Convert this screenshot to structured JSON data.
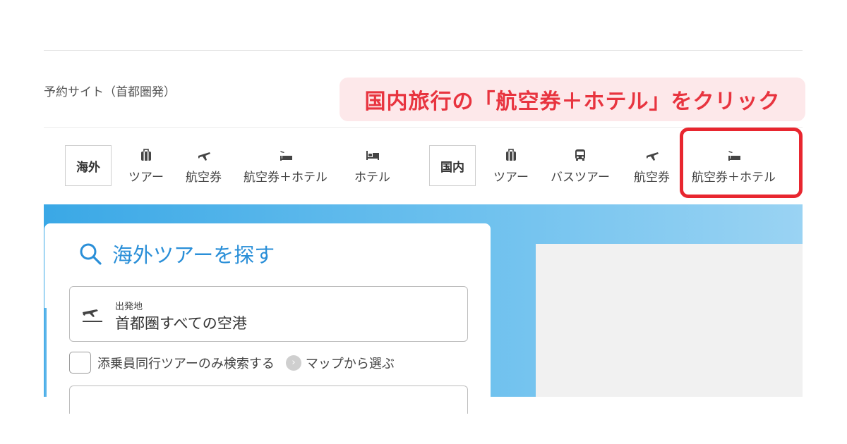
{
  "header": {
    "subtitle": "予約サイト（首都圏発）"
  },
  "callout": {
    "text": "国内旅行の「航空券＋ホテル」をクリック",
    "color": "#e8343f",
    "background": "#fde8ea"
  },
  "nav": {
    "overseas": {
      "badge": "海外",
      "items": [
        {
          "label": "ツアー",
          "icon": "suitcase-icon"
        },
        {
          "label": "航空券",
          "icon": "airplane-icon"
        },
        {
          "label": "航空券＋ホテル",
          "icon": "flight-hotel-icon"
        },
        {
          "label": "ホテル",
          "icon": "bed-icon"
        }
      ]
    },
    "domestic": {
      "badge": "国内",
      "items": [
        {
          "label": "ツアー",
          "icon": "suitcase-icon"
        },
        {
          "label": "バスツアー",
          "icon": "bus-icon"
        },
        {
          "label": "航空券",
          "icon": "airplane-icon"
        },
        {
          "label": "航空券＋ホテル",
          "icon": "flight-hotel-icon"
        }
      ]
    },
    "highlight_color": "#e8262f"
  },
  "search": {
    "title": "海外ツアーを探す",
    "title_color": "#2a8fd8",
    "departure": {
      "label": "出発地",
      "value": "首都圏すべての空港"
    },
    "escort_checkbox_label": "添乗員同行ツアーのみ検索する",
    "map_link": "マップから選ぶ"
  }
}
